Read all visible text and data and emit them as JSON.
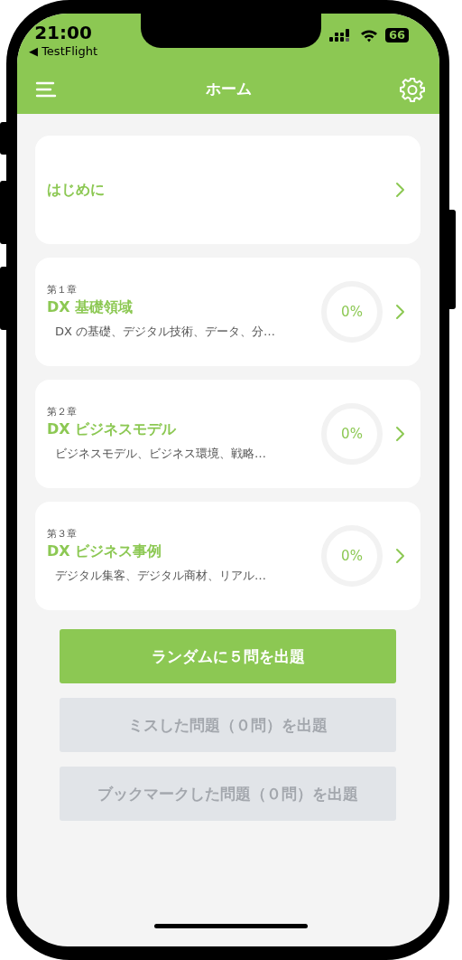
{
  "status_bar": {
    "time": "21:00",
    "back_app": "◀ TestFlight",
    "battery": "66"
  },
  "header": {
    "title": "ホーム"
  },
  "sections": [
    {
      "kind": "intro",
      "title": "はじめに"
    },
    {
      "kind": "chapter",
      "chapter": "第１章",
      "title": "DX 基礎領域",
      "description": "DX の基礎、デジタル技術、データ、分…",
      "level": 0,
      "reading": "0%"
    },
    {
      "kind": "chapter",
      "chapter": "第２章",
      "title": "DX ビジネスモデル",
      "description": "ビジネスモデル、ビジネス環境、戦略…",
      "level": 0,
      "reading": "0%"
    },
    {
      "kind": "chapter",
      "chapter": "第３章",
      "title": "DX ビジネス事例",
      "description": "デジタル集客、デジタル商材、リアル…",
      "level": 0,
      "reading": "0%"
    }
  ],
  "buttons": [
    {
      "label": "ランダムに５問を出題",
      "disabled": false
    },
    {
      "label": "ミスした問題（０問）を出題",
      "disabled": true
    },
    {
      "label": "ブックマークした問題（０問）を出題",
      "disabled": true
    }
  ]
}
